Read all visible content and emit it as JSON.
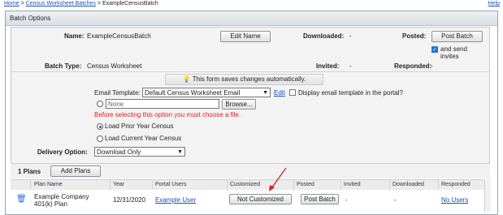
{
  "breadcrumb": {
    "home": "Home",
    "sep1": ">",
    "batches": "Census Worksheet Batches",
    "sep2": ">",
    "current": "ExampleCensusBatch"
  },
  "help": "Help",
  "panel_title": "Batch Options",
  "name": {
    "label": "Name:",
    "value": "ExampleCensusBatch",
    "edit_button": "Edit Name"
  },
  "downloaded": {
    "label": "Downloaded:",
    "value": "-"
  },
  "posted": {
    "label": "Posted:",
    "button": "Post Batch",
    "send_invites_label": "and send invites",
    "send_invites_checked": true
  },
  "batch_type": {
    "label": "Batch Type:",
    "value": "Census Worksheet"
  },
  "invited": {
    "label": "Invited:",
    "value": "-"
  },
  "responded": {
    "label": "Responded:",
    "value": "-"
  },
  "autosave_notice": "This form saves changes automatically.",
  "email_template": {
    "label": "Email Template:",
    "selected": "Default Census Worksheet Email",
    "edit_link": "Edit",
    "display_in_portal_label": "Display email template in the portal?"
  },
  "file": {
    "value": "None",
    "browse_button": "Browse...",
    "warning": "Before selecting this option you must choose a file."
  },
  "load_prior": {
    "label": "Load Prior Year Census",
    "selected": true
  },
  "load_current": {
    "label": "Load Current Year Census",
    "selected": false
  },
  "delivery": {
    "label": "Delivery Option:",
    "selected": "Download Only"
  },
  "plans": {
    "count_label": "1 Plans",
    "add_button": "Add Plans"
  },
  "table": {
    "headers": [
      "Plan Name",
      "Year",
      "Portal Users",
      "Customized",
      "Posted",
      "Invited",
      "Downloaded",
      "Responded"
    ],
    "rows": [
      {
        "plan_name": "Example Company 401(k) Plan",
        "year": "12/31/2020",
        "portal_users": "Example User",
        "customized": "Not Customized",
        "posted": "Post Batch",
        "invited": "-",
        "downloaded": "-",
        "responded": "No Users"
      }
    ]
  },
  "colors": {
    "link": "#1a52b8",
    "warning": "#dd2222",
    "arrow": "#d42020"
  }
}
